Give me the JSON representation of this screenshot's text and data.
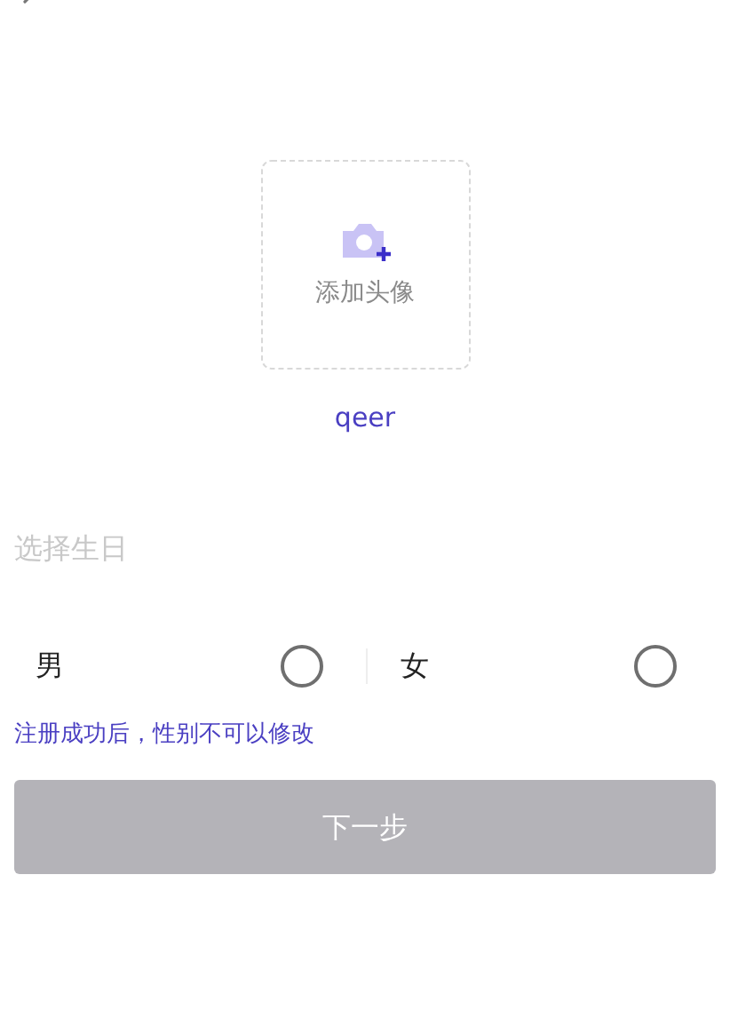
{
  "avatar": {
    "label": "添加头像"
  },
  "nickname": "qeer",
  "birthday": {
    "placeholder": "选择生日"
  },
  "genders": [
    {
      "label": "男",
      "selected": false
    },
    {
      "label": "女",
      "selected": false
    }
  ],
  "notice": "注册成功后，性别不可以修改",
  "next_button": {
    "label": "下一步",
    "disabled": true
  }
}
